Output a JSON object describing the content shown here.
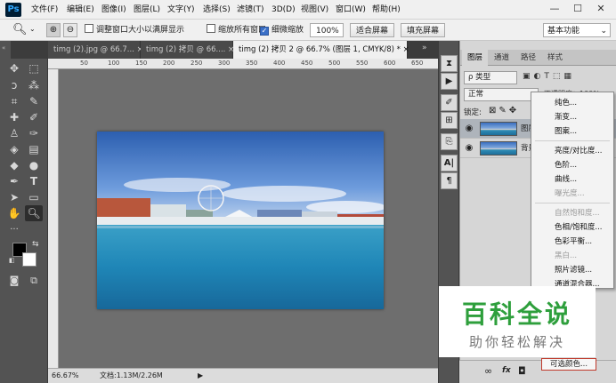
{
  "app": {
    "logo": "Ps"
  },
  "menubar": {
    "items": [
      "文件(F)",
      "编辑(E)",
      "图像(I)",
      "图层(L)",
      "文字(Y)",
      "选择(S)",
      "滤镜(T)",
      "3D(D)",
      "视图(V)",
      "窗口(W)",
      "帮助(H)"
    ],
    "window_controls": {
      "minimize": "—",
      "maximize": "☐",
      "close": "✕"
    }
  },
  "options": {
    "resize_windows": "调整窗口大小以满屏显示",
    "zoom_all_windows": "缩放所有窗口",
    "scrubby_zoom": "细微缩放",
    "zoom_value": "100%",
    "fit_screen": "适合屏幕",
    "fill_screen": "填充屏幕",
    "workspace": "基本功能",
    "checks": {
      "resize_windows": false,
      "zoom_all_windows": false,
      "scrubby_zoom": true
    }
  },
  "tabs": [
    {
      "label": "timg (2).jpg @ 66.7...",
      "close": "×"
    },
    {
      "label": "timg (2) 拷贝 @ 66....",
      "close": "×"
    },
    {
      "label": "timg (2) 拷贝 2 @ 66.7% (图层 1, CMYK/8) *",
      "close": "×"
    }
  ],
  "ruler": {
    "ticks": [
      "50",
      "100",
      "150",
      "200",
      "250",
      "300",
      "350",
      "400",
      "450",
      "500",
      "550",
      "600",
      "650"
    ]
  },
  "status": {
    "zoom": "66.67%",
    "doc": "文档:1.13M/2.26M",
    "arrow": "▶"
  },
  "panel": {
    "tabs": [
      "图层",
      "通道",
      "路径",
      "样式"
    ],
    "filter_label": "ρ 类型",
    "blend_mode": "正常",
    "opacity_label": "不透明度：100%",
    "lock_label": "锁定:",
    "layers": [
      {
        "name": "图层 1"
      },
      {
        "name": "背景"
      }
    ]
  },
  "adjust_menu": {
    "items": [
      {
        "label": "纯色...",
        "enabled": true
      },
      {
        "label": "渐变...",
        "enabled": true
      },
      {
        "label": "图案...",
        "enabled": true
      },
      {
        "sep": true
      },
      {
        "label": "亮度/对比度...",
        "enabled": true
      },
      {
        "label": "色阶...",
        "enabled": true
      },
      {
        "label": "曲线...",
        "enabled": true
      },
      {
        "label": "曝光度...",
        "enabled": false
      },
      {
        "sep": true
      },
      {
        "label": "自然饱和度...",
        "enabled": false
      },
      {
        "label": "色相/饱和度...",
        "enabled": true
      },
      {
        "label": "色彩平衡...",
        "enabled": true
      },
      {
        "label": "黑白...",
        "enabled": false
      },
      {
        "label": "照片滤镜...",
        "enabled": true
      },
      {
        "label": "通道混合器...",
        "enabled": true
      }
    ],
    "highlighted": "可选颜色..."
  },
  "watermark": {
    "title": "百科全说",
    "subtitle": "助你轻松解决",
    "color": "#2e9f3c"
  },
  "panel_bottom_icons": [
    "link-icon",
    "fx-icon",
    "mask-icon"
  ],
  "panel_bottom_labels": [
    "∞",
    "fx",
    "◘"
  ]
}
